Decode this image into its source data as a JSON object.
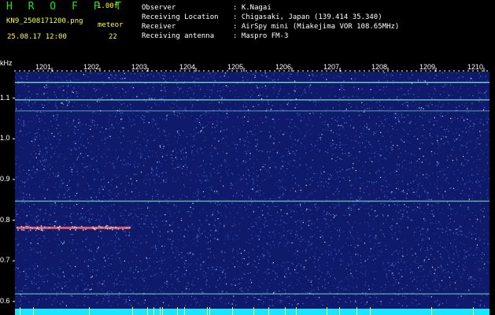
{
  "header": {
    "app_title": "H R O F F T",
    "version": "1.00f",
    "filename": "KN9_2508171200.png",
    "mode": "meteor",
    "datetime": "25.08.17 12:00",
    "count": "22"
  },
  "station": [
    {
      "key": "Observer",
      "value": ": K.Nagai"
    },
    {
      "key": "Receiving Location",
      "value": ": Chigasaki, Japan (139.414 35.340)"
    },
    {
      "key": "Receiver",
      "value": ": AirSpy mini (Miakejima VOR 108.65MHz)"
    },
    {
      "key": "Receiving antenna",
      "value": ": Maspro FM-3"
    }
  ],
  "axis": {
    "unit": "kHz",
    "time_labels": [
      "1201",
      "1202",
      "1203",
      "1204",
      "1205",
      "1206",
      "1207",
      "1208",
      "1209",
      "1210"
    ],
    "freq_labels": [
      "1.1",
      "1.0",
      "0.9",
      "0.8",
      "0.7",
      "0.6"
    ],
    "freq_range": [
      0.59,
      1.165
    ]
  },
  "colors": {
    "background": "#101a6b",
    "noise": "#4c7bd8",
    "carrier": "#7ad6c8",
    "meteor_echo": "#ff6a6a",
    "baseline": "#19e6ff"
  }
}
